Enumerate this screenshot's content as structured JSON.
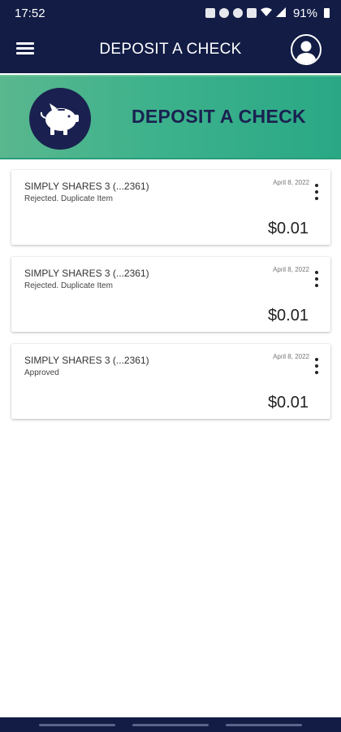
{
  "status_bar": {
    "time": "17:52",
    "battery": "91%",
    "icons": [
      "sim-icon",
      "alarm-icon",
      "bluetooth-icon",
      "mute-icon",
      "wifi-icon",
      "signal-icon",
      "battery-icon"
    ]
  },
  "header": {
    "title": "DEPOSIT A CHECK",
    "menu_icon": "hamburger-menu-icon",
    "profile_icon": "user-profile-icon"
  },
  "banner": {
    "title": "DEPOSIT A CHECK",
    "icon": "piggy-bank-icon"
  },
  "deposits": [
    {
      "account": "SIMPLY SHARES 3 (...2361)",
      "status": "Rejected. Duplicate Item",
      "date": "April 8, 2022",
      "amount": "$0.01"
    },
    {
      "account": "SIMPLY SHARES 3 (...2361)",
      "status": "Rejected. Duplicate Item",
      "date": "April 8, 2022",
      "amount": "$0.01"
    },
    {
      "account": "SIMPLY SHARES 3 (...2361)",
      "status": "Approved",
      "date": "April 8, 2022",
      "amount": "$0.01"
    }
  ],
  "colors": {
    "header_bg": "#121c45",
    "banner_green": "#3db28c",
    "banner_text": "#1a2150"
  }
}
